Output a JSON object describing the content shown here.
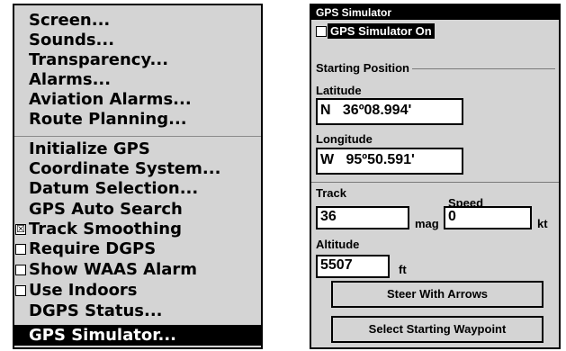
{
  "menu": {
    "items": [
      {
        "label": "Screen..."
      },
      {
        "label": "Sounds..."
      },
      {
        "label": "Transparency..."
      },
      {
        "label": "Alarms..."
      },
      {
        "label": "Aviation Alarms..."
      },
      {
        "label": "Route Planning..."
      },
      {
        "label": "Initialize GPS"
      },
      {
        "label": "Coordinate System..."
      },
      {
        "label": "Datum Selection..."
      },
      {
        "label": "GPS Auto Search"
      },
      {
        "label": "Track Smoothing",
        "checked": true
      },
      {
        "label": "Require DGPS",
        "checked": false
      },
      {
        "label": "Show WAAS Alarm",
        "checked": false
      },
      {
        "label": "Use Indoors",
        "checked": false
      },
      {
        "label": "DGPS Status..."
      },
      {
        "label": "GPS Simulator...",
        "selected": true
      }
    ],
    "check_mark": "☒"
  },
  "dialog": {
    "title": "GPS Simulator",
    "simulator_on": {
      "label": "GPS Simulator On",
      "checked": false
    },
    "starting_position_label": "Starting Position",
    "latitude": {
      "label": "Latitude",
      "value": "N   36º08.994'"
    },
    "longitude": {
      "label": "Longitude",
      "value": "W   95º50.591'"
    },
    "track": {
      "label": "Track",
      "value": "36",
      "unit": "mag"
    },
    "speed": {
      "label": "Speed",
      "value": "0",
      "unit": "kt"
    },
    "altitude": {
      "label": "Altitude",
      "value": "5507",
      "unit": "ft"
    },
    "steer_button": "Steer With Arrows",
    "select_waypoint_button": "Select Starting Waypoint"
  }
}
